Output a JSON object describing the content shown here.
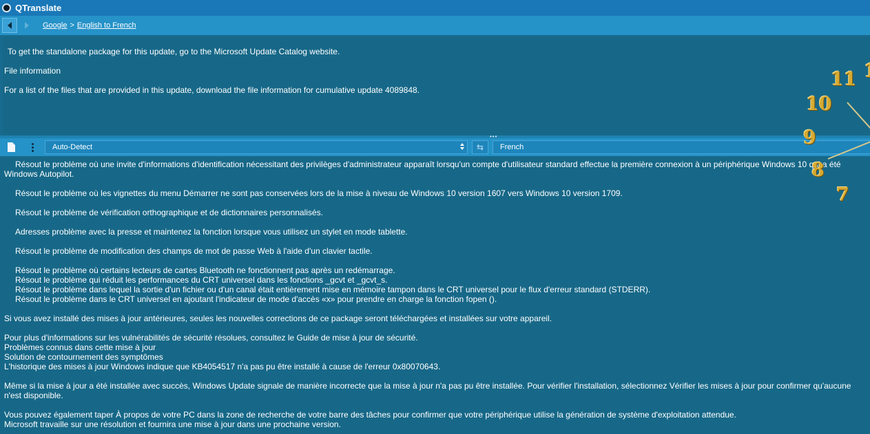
{
  "app": {
    "title": "QTranslate"
  },
  "breadcrumb": {
    "service": "Google",
    "separator": ">",
    "direction": "English to French"
  },
  "source": {
    "lines": [
      "To get the standalone package for this update, go to the Microsoft Update Catalog website.",
      "File information",
      "For a list of the files that are provided in this update, download the file information for cumulative update 4089848."
    ]
  },
  "toolbar": {
    "source_language": "Auto-Detect",
    "target_language": "French"
  },
  "result": {
    "lines": [
      "Résout le problème où une invite d'informations d'identification nécessitant des privilèges d'administrateur apparaît lorsqu'un compte d'utilisateur standard effectue la première connexion à un périphérique Windows 10 qui a été",
      "Windows Autopilot.",
      "Résout le problème où les vignettes du menu Démarrer ne sont pas conservées lors de la mise à niveau de Windows 10 version 1607 vers Windows 10 version 1709.",
      "Résout le problème de vérification orthographique et de dictionnaires personnalisés.",
      "Adresses problème avec la presse et maintenez la fonction lorsque vous utilisez un stylet en mode tablette.",
      "Résout le problème de modification des champs de mot de passe Web à l'aide d'un clavier tactile.",
      "Résout le problème où certains lecteurs de cartes Bluetooth ne fonctionnent pas après un redémarrage.",
      "Résout le problème qui réduit les performances du CRT universel dans les fonctions _gcvt et _gcvt_s.",
      "Résout le problème dans lequel la sortie d'un fichier ou d'un canal était entièrement mise en mémoire tampon dans le CRT universel pour le flux d'erreur standard (STDERR).",
      "Résout le problème dans le CRT universel en ajoutant l'indicateur de mode d'accès «x» pour prendre en charge la fonction fopen ().",
      "Si vous avez installé des mises à jour antérieures, seules les nouvelles corrections de ce package seront téléchargées et installées sur votre appareil.",
      "Pour plus d'informations sur les vulnérabilités de sécurité résolues, consultez le Guide de mise à jour de sécurité.",
      "Problèmes connus dans cette mise à jour",
      "Solution de contournement des symptômes",
      "L'historique des mises à jour Windows indique que KB4054517 n'a pas pu être installé à cause de l'erreur 0x80070643.",
      "Même si la mise à jour a été installée avec succès, Windows Update signale de manière incorrecte que la mise à jour n'a pas pu être installée. Pour vérifier l'installation, sélectionnez Vérifier les mises à jour pour confirmer qu'aucune",
      "n'est disponible.",
      "Vous pouvez également taper À propos de votre PC dans la zone de recherche de votre barre des tâches pour confirmer que votre périphérique utilise la génération de système d'exploitation attendue.",
      "Microsoft travaille sur une résolution et fournira une mise à jour dans une prochaine version."
    ]
  },
  "desktop_clock": {
    "numerals": [
      "11",
      "10",
      "9",
      "8",
      "7",
      "1"
    ]
  },
  "colors": {
    "titlebar": "#1a78b8",
    "toolbar": "#2592c8",
    "panel": "#176888",
    "clock_numerals": "#d6aa32"
  }
}
